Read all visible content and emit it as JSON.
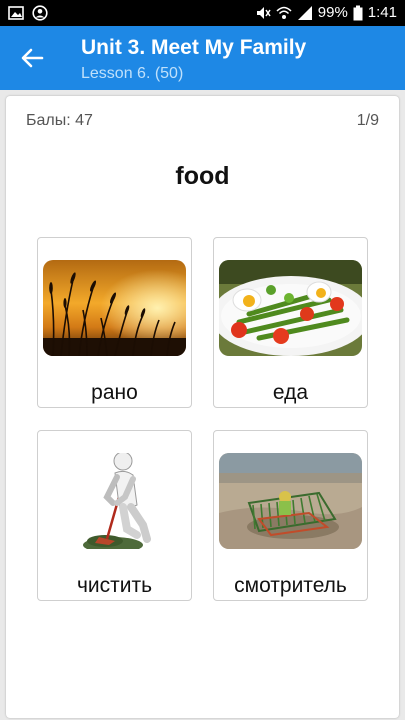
{
  "status_bar": {
    "battery": "99%",
    "time": "1:41",
    "icons": [
      "image-icon",
      "account-circle-icon",
      "mute-icon",
      "wifi-icon",
      "signal-icon",
      "battery-icon"
    ]
  },
  "app_bar": {
    "title": "Unit 3. Meet My Family",
    "subtitle": "Lesson 6. (50)",
    "back_icon": "arrow-back-icon",
    "color": "#1e88e5"
  },
  "quiz": {
    "score_label": "Балы: 47",
    "progress": "1/9",
    "word": "food",
    "options": [
      {
        "label": "рано",
        "image": "sunset-wheat-silhouette"
      },
      {
        "label": "еда",
        "image": "plate-of-salad-with-eggs"
      },
      {
        "label": "чистить",
        "image": "white-figure-sweeping"
      },
      {
        "label": "смотритель",
        "image": "playpen-on-beach"
      }
    ]
  }
}
